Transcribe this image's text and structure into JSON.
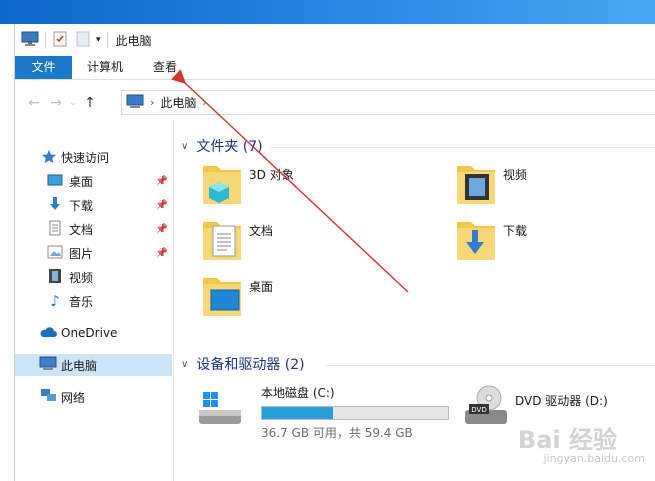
{
  "window": {
    "title": "此电脑"
  },
  "ribbon": {
    "tabs": [
      {
        "label": "文件"
      },
      {
        "label": "计算机"
      },
      {
        "label": "查看"
      }
    ]
  },
  "address": {
    "crumbs": [
      {
        "label": "此电脑"
      }
    ]
  },
  "sidebar": {
    "items": [
      {
        "label": "快速访问",
        "icon": "star-icon"
      },
      {
        "label": "桌面",
        "icon": "desktop-icon",
        "pinned": true
      },
      {
        "label": "下载",
        "icon": "download-icon",
        "pinned": true
      },
      {
        "label": "文档",
        "icon": "document-icon",
        "pinned": true
      },
      {
        "label": "图片",
        "icon": "picture-icon",
        "pinned": true
      },
      {
        "label": "视频",
        "icon": "video-icon"
      },
      {
        "label": "音乐",
        "icon": "music-icon"
      },
      {
        "label": "OneDrive",
        "icon": "cloud-icon"
      },
      {
        "label": "此电脑",
        "icon": "computer-icon",
        "selected": true
      },
      {
        "label": "网络",
        "icon": "network-icon"
      }
    ]
  },
  "content": {
    "folders_group": "文件夹 (7)",
    "drives_group": "设备和驱动器 (2)",
    "folders": [
      {
        "label": "3D 对象",
        "icon": "3d-objects-icon"
      },
      {
        "label": "视频",
        "icon": "video-folder-icon"
      },
      {
        "label": "文档",
        "icon": "documents-folder-icon"
      },
      {
        "label": "下载",
        "icon": "downloads-folder-icon"
      },
      {
        "label": "桌面",
        "icon": "desktop-folder-icon"
      }
    ],
    "drives": [
      {
        "label": "本地磁盘 (C:)",
        "detail": "36.7 GB 可用，共 59.4 GB",
        "used_fraction": 0.382
      },
      {
        "label": "DVD 驱动器 (D:)"
      }
    ]
  },
  "watermark": {
    "brand": "Bai 经验",
    "url": "jingyan.baidu.com"
  },
  "colors": {
    "accent": "#1979ca",
    "selected": "#cce4f7",
    "group_heading": "#1e3287",
    "drive_bar": "#26a0da",
    "annotation_arrow": "#d9342b"
  }
}
